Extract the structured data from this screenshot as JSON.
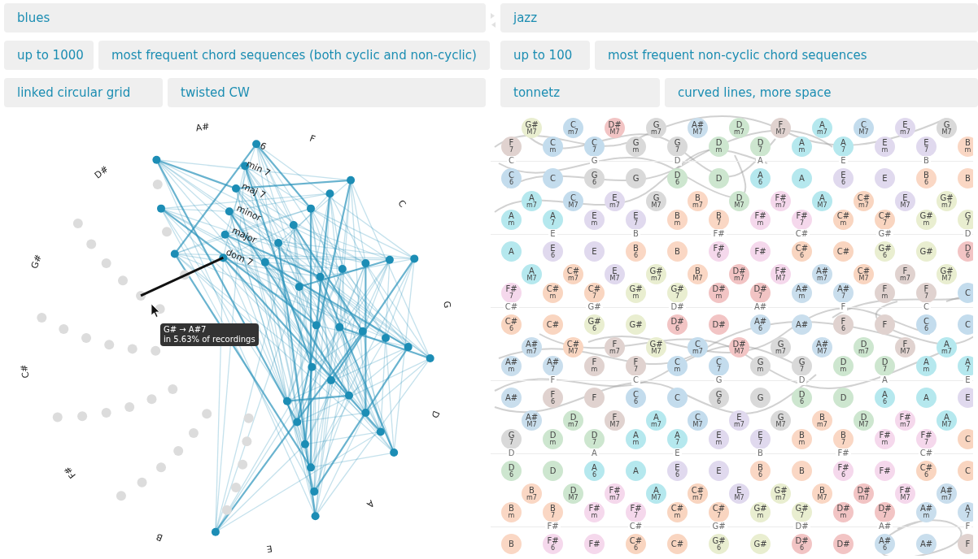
{
  "panels": [
    {
      "dataset": "blues",
      "limit": "up to 1000",
      "sequences": "most frequent chord sequences (both cyclic and non-cyclic)",
      "layout": "linked circular grid",
      "style": "twisted CW"
    },
    {
      "dataset": "jazz",
      "limit": "up to 100",
      "sequences": "most frequent non-cyclic chord sequences",
      "layout": "tonnetz",
      "style": "curved lines, more space"
    }
  ],
  "circular_graph": {
    "note_labels": [
      "A#",
      "F",
      "C",
      "G",
      "D",
      "A",
      "E",
      "B",
      "F#",
      "C#",
      "G#",
      "D#"
    ],
    "ring_labels": [
      "dom 7",
      "major",
      "minor",
      "maj 7",
      "min 7",
      "6"
    ],
    "tooltip": {
      "transition": "G# → A#7",
      "share": "in 5.63% of recordings"
    }
  },
  "tonnetz": {
    "rows": [
      {
        "kind": "sevenths",
        "cells": [
          {
            "root": "G#",
            "type": "M7",
            "color": "#e9eed0"
          },
          {
            "root": "C",
            "type": "m7",
            "color": "#c3dced"
          },
          {
            "root": "D#",
            "type": "M7",
            "color": "#f2c4c4"
          },
          {
            "root": "G",
            "type": "m7",
            "color": "#d9d9d9"
          },
          {
            "root": "A#",
            "type": "M7",
            "color": "#c9deed"
          },
          {
            "root": "D",
            "type": "m7",
            "color": "#cde6cf"
          },
          {
            "root": "F",
            "type": "M7",
            "color": "#e0d2cf"
          },
          {
            "root": "A",
            "type": "m7",
            "color": "#b5e8ee"
          },
          {
            "root": "C",
            "type": "M7",
            "color": "#c3dced"
          },
          {
            "root": "E",
            "type": "m7",
            "color": "#e0d9ee"
          },
          {
            "root": "G",
            "type": "M7",
            "color": "#d9d9d9"
          }
        ]
      },
      {
        "kind": "chords",
        "cells": [
          {
            "root": "F",
            "type": "7",
            "color": "#e0d2cf"
          },
          {
            "root": "C",
            "type": "m",
            "color": "#c3dced"
          },
          {
            "root": "C",
            "type": "7",
            "color": "#c3dced"
          },
          {
            "root": "G",
            "type": "m",
            "color": "#d9d9d9"
          },
          {
            "root": "G",
            "type": "7",
            "color": "#d9d9d9"
          },
          {
            "root": "D",
            "type": "m",
            "color": "#cde6cf"
          },
          {
            "root": "D",
            "type": "7",
            "color": "#cde6cf"
          },
          {
            "root": "A",
            "type": "m",
            "color": "#b5e8ee"
          },
          {
            "root": "A",
            "type": "7",
            "color": "#b5e8ee"
          },
          {
            "root": "E",
            "type": "m",
            "color": "#e0d9ee"
          },
          {
            "root": "E",
            "type": "7",
            "color": "#e0d9ee"
          },
          {
            "root": "B",
            "type": "m",
            "color": "#fad7c4"
          }
        ]
      },
      {
        "kind": "notes",
        "cells": [
          {
            "note": "C"
          },
          {
            "note": "G"
          },
          {
            "note": "D"
          },
          {
            "note": "A"
          },
          {
            "note": "E"
          },
          {
            "note": "B"
          }
        ]
      },
      {
        "kind": "triads",
        "cells": [
          {
            "root": "C",
            "type": "6",
            "color": "#c3dced"
          },
          {
            "root": "C",
            "color": "#c3dced"
          },
          {
            "root": "G",
            "type": "6",
            "color": "#d9d9d9"
          },
          {
            "root": "G",
            "color": "#d9d9d9"
          },
          {
            "root": "D",
            "type": "6",
            "color": "#cde6cf"
          },
          {
            "root": "D",
            "color": "#cde6cf"
          },
          {
            "root": "A",
            "type": "6",
            "color": "#b5e8ee"
          },
          {
            "root": "A",
            "color": "#b5e8ee"
          },
          {
            "root": "E",
            "type": "6",
            "color": "#e0d9ee"
          },
          {
            "root": "E",
            "color": "#e0d9ee"
          },
          {
            "root": "B",
            "type": "6",
            "color": "#fad7c4"
          },
          {
            "root": "B",
            "color": "#fad7c4"
          }
        ]
      },
      {
        "kind": "sevenths",
        "cells": [
          {
            "root": "A",
            "type": "m7",
            "color": "#b5e8ee"
          },
          {
            "root": "C",
            "type": "M7",
            "color": "#c3dced"
          },
          {
            "root": "E",
            "type": "m7",
            "color": "#e0d9ee"
          },
          {
            "root": "G",
            "type": "M7",
            "color": "#d9d9d9"
          },
          {
            "root": "B",
            "type": "m7",
            "color": "#fad7c4"
          },
          {
            "root": "D",
            "type": "M7",
            "color": "#cde6cf"
          },
          {
            "root": "F#",
            "type": "m7",
            "color": "#f5d8ec"
          },
          {
            "root": "A",
            "type": "M7",
            "color": "#b5e8ee"
          },
          {
            "root": "C#",
            "type": "m7",
            "color": "#f9d5c0"
          },
          {
            "root": "E",
            "type": "M7",
            "color": "#e0d9ee"
          },
          {
            "root": "G#",
            "type": "m7",
            "color": "#e9eed0"
          }
        ]
      },
      {
        "kind": "chords",
        "cells": [
          {
            "root": "A",
            "type": "m",
            "color": "#b5e8ee"
          },
          {
            "root": "A",
            "type": "7",
            "color": "#b5e8ee"
          },
          {
            "root": "E",
            "type": "m",
            "color": "#e0d9ee"
          },
          {
            "root": "E",
            "type": "7",
            "color": "#e0d9ee"
          },
          {
            "root": "B",
            "type": "m",
            "color": "#fad7c4"
          },
          {
            "root": "B",
            "type": "7",
            "color": "#fad7c4"
          },
          {
            "root": "F#",
            "type": "m",
            "color": "#f5d8ec"
          },
          {
            "root": "F#",
            "type": "7",
            "color": "#f5d8ec"
          },
          {
            "root": "C#",
            "type": "m",
            "color": "#f9d5c0"
          },
          {
            "root": "C#",
            "type": "7",
            "color": "#f9d5c0"
          },
          {
            "root": "G#",
            "type": "m",
            "color": "#e9eed0"
          },
          {
            "root": "G",
            "type": "7",
            "color": "#e9eed0"
          }
        ]
      },
      {
        "kind": "notes",
        "cells": [
          {
            "note": "E"
          },
          {
            "note": "B"
          },
          {
            "note": "F#"
          },
          {
            "note": "C#"
          },
          {
            "note": "G#"
          },
          {
            "note": "D"
          }
        ]
      },
      {
        "kind": "triads",
        "cells": [
          {
            "root": "A",
            "color": "#b5e8ee"
          },
          {
            "root": "E",
            "type": "6",
            "color": "#e0d9ee"
          },
          {
            "root": "E",
            "color": "#e0d9ee"
          },
          {
            "root": "B",
            "type": "6",
            "color": "#fad7c4"
          },
          {
            "root": "B",
            "color": "#fad7c4"
          },
          {
            "root": "F#",
            "type": "6",
            "color": "#f5d8ec"
          },
          {
            "root": "F#",
            "color": "#f5d8ec"
          },
          {
            "root": "C#",
            "type": "6",
            "color": "#f9d5c0"
          },
          {
            "root": "C#",
            "color": "#f9d5c0"
          },
          {
            "root": "G#",
            "type": "6",
            "color": "#e9eed0"
          },
          {
            "root": "G#",
            "color": "#e9eed0"
          },
          {
            "root": "D",
            "type": "6",
            "color": "#f2c4c4"
          }
        ]
      },
      {
        "kind": "sevenths",
        "cells": [
          {
            "root": "A",
            "type": "M7",
            "color": "#b5e8ee"
          },
          {
            "root": "C#",
            "type": "m7",
            "color": "#f9d5c0"
          },
          {
            "root": "E",
            "type": "M7",
            "color": "#e0d9ee"
          },
          {
            "root": "G#",
            "type": "m7",
            "color": "#e9eed0"
          },
          {
            "root": "B",
            "type": "M7",
            "color": "#fad7c4"
          },
          {
            "root": "D#",
            "type": "m7",
            "color": "#f2c4c4"
          },
          {
            "root": "F#",
            "type": "M7",
            "color": "#f5d8ec"
          },
          {
            "root": "A#",
            "type": "m7",
            "color": "#c9deed"
          },
          {
            "root": "C#",
            "type": "M7",
            "color": "#f9d5c0"
          },
          {
            "root": "F",
            "type": "m7",
            "color": "#e0d2cf"
          },
          {
            "root": "G#",
            "type": "M7",
            "color": "#e9eed0"
          }
        ]
      },
      {
        "kind": "chords",
        "cells": [
          {
            "root": "F#",
            "type": "7",
            "color": "#f5d8ec"
          },
          {
            "root": "C#",
            "type": "m",
            "color": "#f9d5c0"
          },
          {
            "root": "C#",
            "type": "7",
            "color": "#f9d5c0"
          },
          {
            "root": "G#",
            "type": "m",
            "color": "#e9eed0"
          },
          {
            "root": "G#",
            "type": "7",
            "color": "#e9eed0"
          },
          {
            "root": "D#",
            "type": "m",
            "color": "#f2c4c4"
          },
          {
            "root": "D#",
            "type": "7",
            "color": "#f2c4c4"
          },
          {
            "root": "A#",
            "type": "m",
            "color": "#c9deed"
          },
          {
            "root": "A#",
            "type": "7",
            "color": "#c9deed"
          },
          {
            "root": "F",
            "type": "m",
            "color": "#e0d2cf"
          },
          {
            "root": "F",
            "type": "7",
            "color": "#e0d2cf"
          },
          {
            "root": "C",
            "color": "#c3dced"
          }
        ]
      },
      {
        "kind": "notes",
        "cells": [
          {
            "note": "C#"
          },
          {
            "note": "G#"
          },
          {
            "note": "D#"
          },
          {
            "note": "A#"
          },
          {
            "note": "F"
          },
          {
            "note": "C"
          }
        ]
      },
      {
        "kind": "triads",
        "cells": [
          {
            "root": "C#",
            "type": "6",
            "color": "#f9d5c0"
          },
          {
            "root": "C#",
            "color": "#f9d5c0"
          },
          {
            "root": "G#",
            "type": "6",
            "color": "#e9eed0"
          },
          {
            "root": "G#",
            "color": "#e9eed0"
          },
          {
            "root": "D#",
            "type": "6",
            "color": "#f2c4c4"
          },
          {
            "root": "D#",
            "color": "#f2c4c4"
          },
          {
            "root": "A#",
            "type": "6",
            "color": "#c9deed"
          },
          {
            "root": "A#",
            "color": "#c9deed"
          },
          {
            "root": "F",
            "type": "6",
            "color": "#e0d2cf"
          },
          {
            "root": "F",
            "color": "#e0d2cf"
          },
          {
            "root": "C",
            "type": "6",
            "color": "#c3dced"
          },
          {
            "root": "C",
            "color": "#c3dced"
          }
        ]
      },
      {
        "kind": "sevenths",
        "cells": [
          {
            "root": "A#",
            "type": "m7",
            "color": "#c9deed"
          },
          {
            "root": "C#",
            "type": "M7",
            "color": "#f9d5c0"
          },
          {
            "root": "F",
            "type": "m7",
            "color": "#e0d2cf"
          },
          {
            "root": "G#",
            "type": "M7",
            "color": "#e9eed0"
          },
          {
            "root": "C",
            "type": "m7",
            "color": "#c3dced"
          },
          {
            "root": "D#",
            "type": "M7",
            "color": "#f2c4c4"
          },
          {
            "root": "G",
            "type": "m7",
            "color": "#d9d9d9"
          },
          {
            "root": "A#",
            "type": "M7",
            "color": "#c9deed"
          },
          {
            "root": "D",
            "type": "m7",
            "color": "#cde6cf"
          },
          {
            "root": "F",
            "type": "M7",
            "color": "#e0d2cf"
          },
          {
            "root": "A",
            "type": "m7",
            "color": "#b5e8ee"
          }
        ]
      },
      {
        "kind": "chords",
        "cells": [
          {
            "root": "A#",
            "type": "m",
            "color": "#c9deed"
          },
          {
            "root": "A#",
            "type": "7",
            "color": "#c9deed"
          },
          {
            "root": "F",
            "type": "m",
            "color": "#e0d2cf"
          },
          {
            "root": "F",
            "type": "7",
            "color": "#e0d2cf"
          },
          {
            "root": "C",
            "type": "m",
            "color": "#c3dced"
          },
          {
            "root": "C",
            "type": "7",
            "color": "#c3dced"
          },
          {
            "root": "G",
            "type": "m",
            "color": "#d9d9d9"
          },
          {
            "root": "G",
            "type": "7",
            "color": "#d9d9d9"
          },
          {
            "root": "D",
            "type": "m",
            "color": "#cde6cf"
          },
          {
            "root": "D",
            "type": "7",
            "color": "#cde6cf"
          },
          {
            "root": "A",
            "type": "m",
            "color": "#b5e8ee"
          },
          {
            "root": "A",
            "type": "7",
            "color": "#b5e8ee"
          }
        ]
      },
      {
        "kind": "notes",
        "cells": [
          {
            "note": "F"
          },
          {
            "note": "C"
          },
          {
            "note": "G"
          },
          {
            "note": "D"
          },
          {
            "note": "A"
          },
          {
            "note": "E"
          }
        ]
      },
      {
        "kind": "triads",
        "cells": [
          {
            "root": "A#",
            "color": "#c9deed"
          },
          {
            "root": "F",
            "type": "6",
            "color": "#e0d2cf"
          },
          {
            "root": "F",
            "color": "#e0d2cf"
          },
          {
            "root": "C",
            "type": "6",
            "color": "#c3dced"
          },
          {
            "root": "C",
            "color": "#c3dced"
          },
          {
            "root": "G",
            "type": "6",
            "color": "#d9d9d9"
          },
          {
            "root": "G",
            "color": "#d9d9d9"
          },
          {
            "root": "D",
            "type": "6",
            "color": "#cde6cf"
          },
          {
            "root": "D",
            "color": "#cde6cf"
          },
          {
            "root": "A",
            "type": "6",
            "color": "#b5e8ee"
          },
          {
            "root": "A",
            "color": "#b5e8ee"
          },
          {
            "root": "E",
            "color": "#e0d9ee"
          }
        ]
      },
      {
        "kind": "sevenths",
        "cells": [
          {
            "root": "A#",
            "type": "M7",
            "color": "#c9deed"
          },
          {
            "root": "D",
            "type": "m7",
            "color": "#cde6cf"
          },
          {
            "root": "F",
            "type": "M7",
            "color": "#e0d2cf"
          },
          {
            "root": "A",
            "type": "m7",
            "color": "#b5e8ee"
          },
          {
            "root": "C",
            "type": "M7",
            "color": "#c3dced"
          },
          {
            "root": "E",
            "type": "m7",
            "color": "#e0d9ee"
          },
          {
            "root": "G",
            "type": "M7",
            "color": "#d9d9d9"
          },
          {
            "root": "B",
            "type": "m7",
            "color": "#fad7c4"
          },
          {
            "root": "D",
            "type": "M7",
            "color": "#cde6cf"
          },
          {
            "root": "F#",
            "type": "m7",
            "color": "#f5d8ec"
          },
          {
            "root": "A",
            "type": "M7",
            "color": "#b5e8ee"
          }
        ]
      },
      {
        "kind": "chords",
        "cells": [
          {
            "root": "G",
            "type": "7",
            "color": "#d9d9d9"
          },
          {
            "root": "D",
            "type": "m",
            "color": "#cde6cf"
          },
          {
            "root": "D",
            "type": "7",
            "color": "#cde6cf"
          },
          {
            "root": "A",
            "type": "m",
            "color": "#b5e8ee"
          },
          {
            "root": "A",
            "type": "7",
            "color": "#b5e8ee"
          },
          {
            "root": "E",
            "type": "m",
            "color": "#e0d9ee"
          },
          {
            "root": "E",
            "type": "7",
            "color": "#e0d9ee"
          },
          {
            "root": "B",
            "type": "m",
            "color": "#fad7c4"
          },
          {
            "root": "B",
            "type": "7",
            "color": "#fad7c4"
          },
          {
            "root": "F#",
            "type": "m",
            "color": "#f5d8ec"
          },
          {
            "root": "F#",
            "type": "7",
            "color": "#f5d8ec"
          },
          {
            "root": "C",
            "color": "#f9d5c0"
          }
        ]
      },
      {
        "kind": "notes",
        "cells": [
          {
            "note": "D"
          },
          {
            "note": "A"
          },
          {
            "note": "E"
          },
          {
            "note": "B"
          },
          {
            "note": "F#"
          },
          {
            "note": "C#"
          }
        ]
      },
      {
        "kind": "triads",
        "cells": [
          {
            "root": "D",
            "type": "6",
            "color": "#cde6cf"
          },
          {
            "root": "D",
            "color": "#cde6cf"
          },
          {
            "root": "A",
            "type": "6",
            "color": "#b5e8ee"
          },
          {
            "root": "A",
            "color": "#b5e8ee"
          },
          {
            "root": "E",
            "type": "6",
            "color": "#e0d9ee"
          },
          {
            "root": "E",
            "color": "#e0d9ee"
          },
          {
            "root": "B",
            "type": "6",
            "color": "#fad7c4"
          },
          {
            "root": "B",
            "color": "#fad7c4"
          },
          {
            "root": "F#",
            "type": "6",
            "color": "#f5d8ec"
          },
          {
            "root": "F#",
            "color": "#f5d8ec"
          },
          {
            "root": "C#",
            "type": "6",
            "color": "#f9d5c0"
          },
          {
            "root": "C",
            "color": "#f9d5c0"
          }
        ]
      },
      {
        "kind": "sevenths",
        "cells": [
          {
            "root": "B",
            "type": "m7",
            "color": "#fad7c4"
          },
          {
            "root": "D",
            "type": "M7",
            "color": "#cde6cf"
          },
          {
            "root": "F#",
            "type": "m7",
            "color": "#f5d8ec"
          },
          {
            "root": "A",
            "type": "M7",
            "color": "#b5e8ee"
          },
          {
            "root": "C#",
            "type": "m7",
            "color": "#f9d5c0"
          },
          {
            "root": "E",
            "type": "M7",
            "color": "#e0d9ee"
          },
          {
            "root": "G#",
            "type": "m7",
            "color": "#e9eed0"
          },
          {
            "root": "B",
            "type": "M7",
            "color": "#fad7c4"
          },
          {
            "root": "D#",
            "type": "m7",
            "color": "#f2c4c4"
          },
          {
            "root": "F#",
            "type": "M7",
            "color": "#f5d8ec"
          },
          {
            "root": "A#",
            "type": "m7",
            "color": "#c9deed"
          }
        ]
      },
      {
        "kind": "chords",
        "cells": [
          {
            "root": "B",
            "type": "m",
            "color": "#fad7c4"
          },
          {
            "root": "B",
            "type": "7",
            "color": "#fad7c4"
          },
          {
            "root": "F#",
            "type": "m",
            "color": "#f5d8ec"
          },
          {
            "root": "F#",
            "type": "7",
            "color": "#f5d8ec"
          },
          {
            "root": "C#",
            "type": "m",
            "color": "#f9d5c0"
          },
          {
            "root": "C#",
            "type": "7",
            "color": "#f9d5c0"
          },
          {
            "root": "G#",
            "type": "m",
            "color": "#e9eed0"
          },
          {
            "root": "G#",
            "type": "7",
            "color": "#e9eed0"
          },
          {
            "root": "D#",
            "type": "m",
            "color": "#f2c4c4"
          },
          {
            "root": "D#",
            "type": "7",
            "color": "#f2c4c4"
          },
          {
            "root": "A#",
            "type": "m",
            "color": "#c9deed"
          },
          {
            "root": "A",
            "type": "7",
            "color": "#c9deed"
          }
        ]
      },
      {
        "kind": "notes",
        "cells": [
          {
            "note": "F#"
          },
          {
            "note": "C#"
          },
          {
            "note": "G#"
          },
          {
            "note": "D#"
          },
          {
            "note": "A#"
          },
          {
            "note": "F"
          }
        ]
      },
      {
        "kind": "triads",
        "cells": [
          {
            "root": "B",
            "color": "#fad7c4"
          },
          {
            "root": "F#",
            "type": "6",
            "color": "#f5d8ec"
          },
          {
            "root": "F#",
            "color": "#f5d8ec"
          },
          {
            "root": "C#",
            "type": "6",
            "color": "#f9d5c0"
          },
          {
            "root": "C#",
            "color": "#f9d5c0"
          },
          {
            "root": "G#",
            "type": "6",
            "color": "#e9eed0"
          },
          {
            "root": "G#",
            "color": "#e9eed0"
          },
          {
            "root": "D#",
            "type": "6",
            "color": "#f2c4c4"
          },
          {
            "root": "D#",
            "color": "#f2c4c4"
          },
          {
            "root": "A#",
            "type": "6",
            "color": "#c9deed"
          },
          {
            "root": "A#",
            "color": "#c9deed"
          },
          {
            "root": "F",
            "color": "#e0d2cf"
          }
        ]
      }
    ]
  }
}
